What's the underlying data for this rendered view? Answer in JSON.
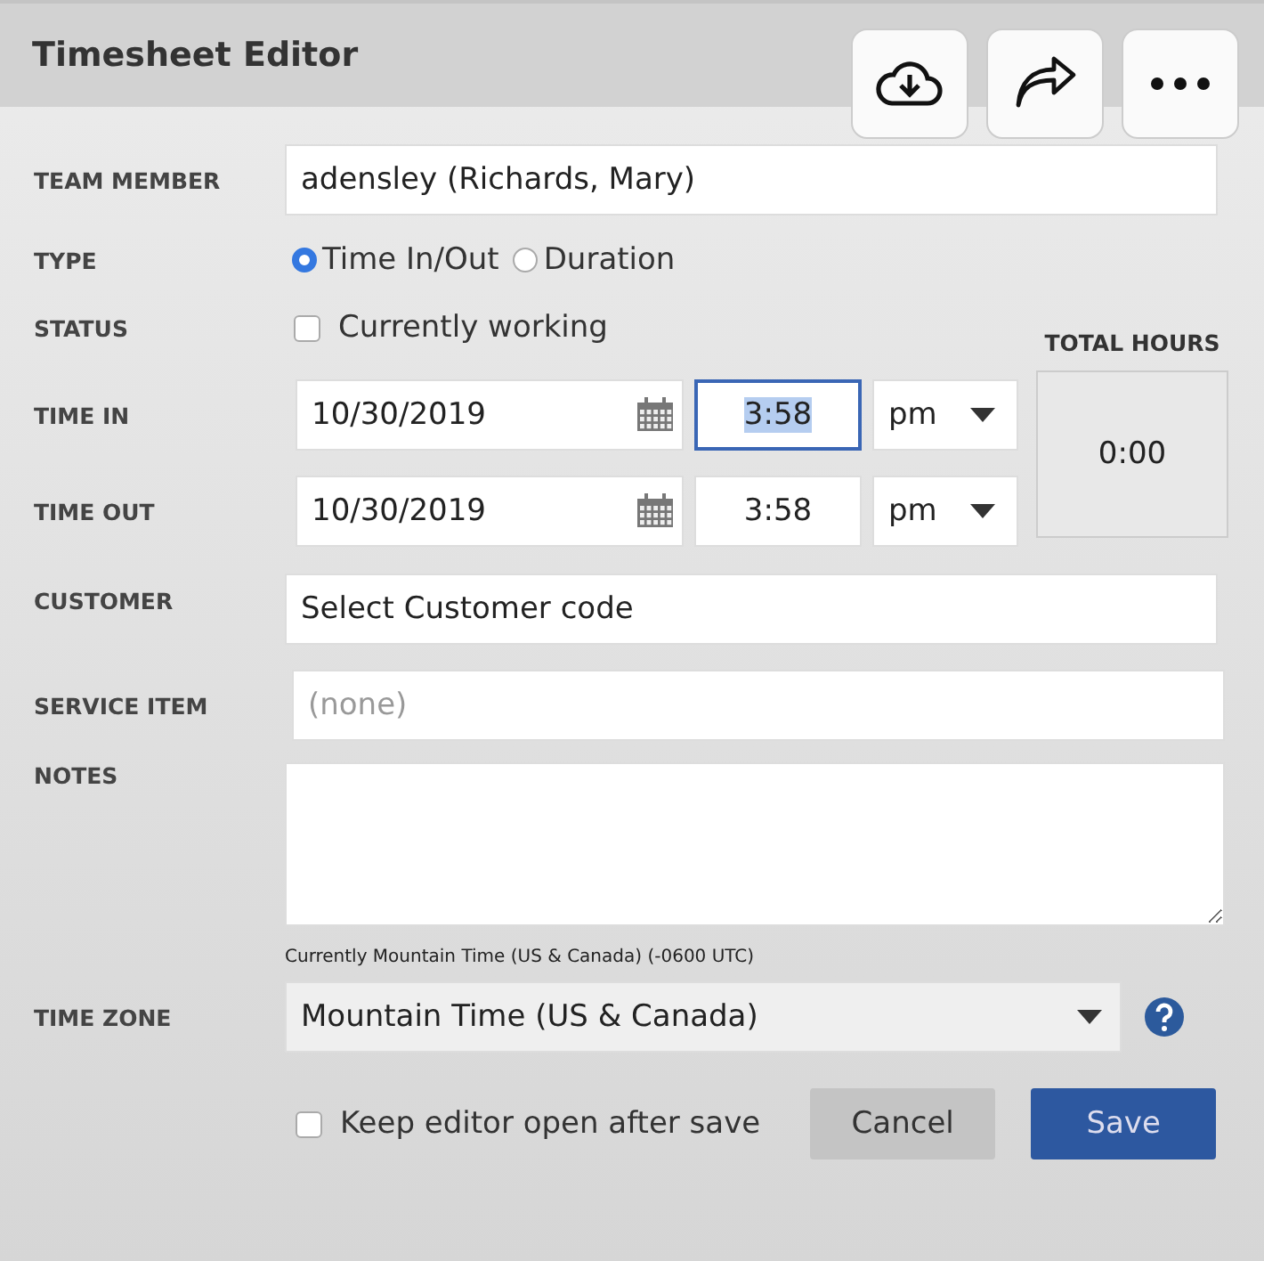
{
  "window": {
    "title": "Timesheet Editor"
  },
  "toolbar": [
    {
      "kind": "download"
    },
    {
      "kind": "share"
    },
    {
      "kind": "more"
    }
  ],
  "team_member": {
    "label": "TEAM MEMBER",
    "value": "adensley (Richards, Mary)"
  },
  "type": {
    "label": "TYPE",
    "options": [
      {
        "label": "Time In/Out",
        "selected": true
      },
      {
        "label": "Duration",
        "selected": false
      }
    ]
  },
  "status": {
    "label": "STATUS",
    "option": "Currently working",
    "checked": false
  },
  "times": [
    {
      "label": "TIME IN",
      "date": "10/30/2019",
      "time": "3:58",
      "time_selected": true,
      "period": "pm"
    },
    {
      "label": "TIME OUT",
      "date": "10/30/2019",
      "time": "3:58",
      "time_selected": false,
      "period": "pm"
    }
  ],
  "total_hours": {
    "label": "TOTAL HOURS",
    "value": "0:00"
  },
  "customer": {
    "label": "CUSTOMER",
    "value": "Select Customer code"
  },
  "service_item": {
    "label": "SERVICE ITEM",
    "placeholder": "(none)"
  },
  "notes": {
    "label": "NOTES"
  },
  "time_zone": {
    "note": "Currently Mountain Time (US & Canada) (-0600 UTC)",
    "label": "TIME ZONE",
    "value": "Mountain Time (US & Canada)"
  },
  "keep_open": {
    "label": "Keep editor open after save",
    "checked": false
  },
  "buttons": [
    {
      "label": "Cancel",
      "kind": "secondary"
    },
    {
      "label": "Save",
      "kind": "primary"
    }
  ]
}
